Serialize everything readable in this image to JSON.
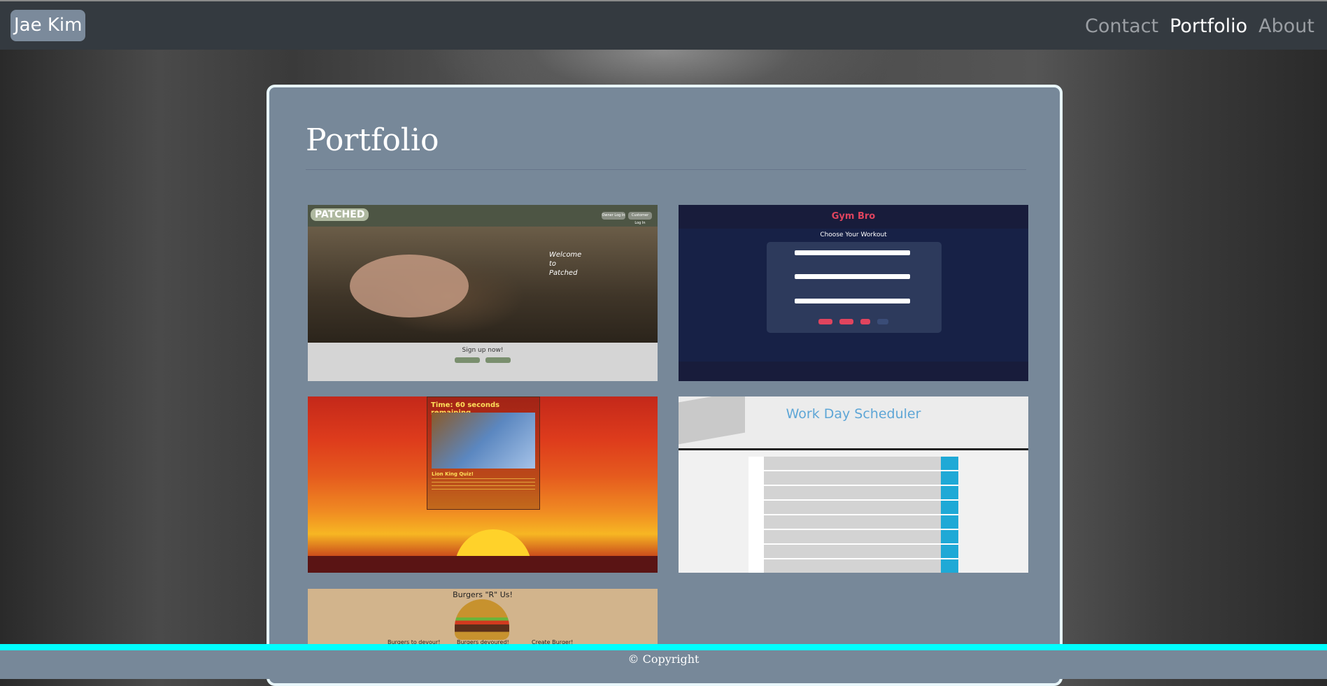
{
  "nav": {
    "brand": "Jae Kim",
    "links": [
      "Contact",
      "Portfolio",
      "About"
    ],
    "active": "Portfolio"
  },
  "main": {
    "title": "Portfolio",
    "projects": [
      {
        "name": "Patched",
        "logo": "PATCHED",
        "nav_buttons": [
          "Owner Log In",
          "Customer Log In"
        ],
        "welcome": "Welcome to Patched",
        "cta": "Sign up now!"
      },
      {
        "name": "Gym Bro",
        "logo": "Gym Bro",
        "heading": "Choose Your Workout"
      },
      {
        "name": "Lion King Quiz",
        "timer": "Time: 60 seconds remaining.",
        "heading": "Lion King Quiz!"
      },
      {
        "name": "Work Day Scheduler",
        "title": "Work Day Scheduler"
      },
      {
        "name": "Burgers R Us",
        "title": "Burgers \"R\" Us!",
        "labels": [
          "Burgers to devour!",
          "Burgers devoured!",
          "Create Burger!"
        ]
      }
    ]
  },
  "footer": {
    "text": "© Copyright"
  },
  "colors": {
    "navbar": "#343a40",
    "brand_bg": "#7b8a9b",
    "card_bg": "#778899",
    "card_border": "#e8f6fa",
    "footer_line": "#00ffff",
    "nav_inactive": "#9a9ea3"
  }
}
